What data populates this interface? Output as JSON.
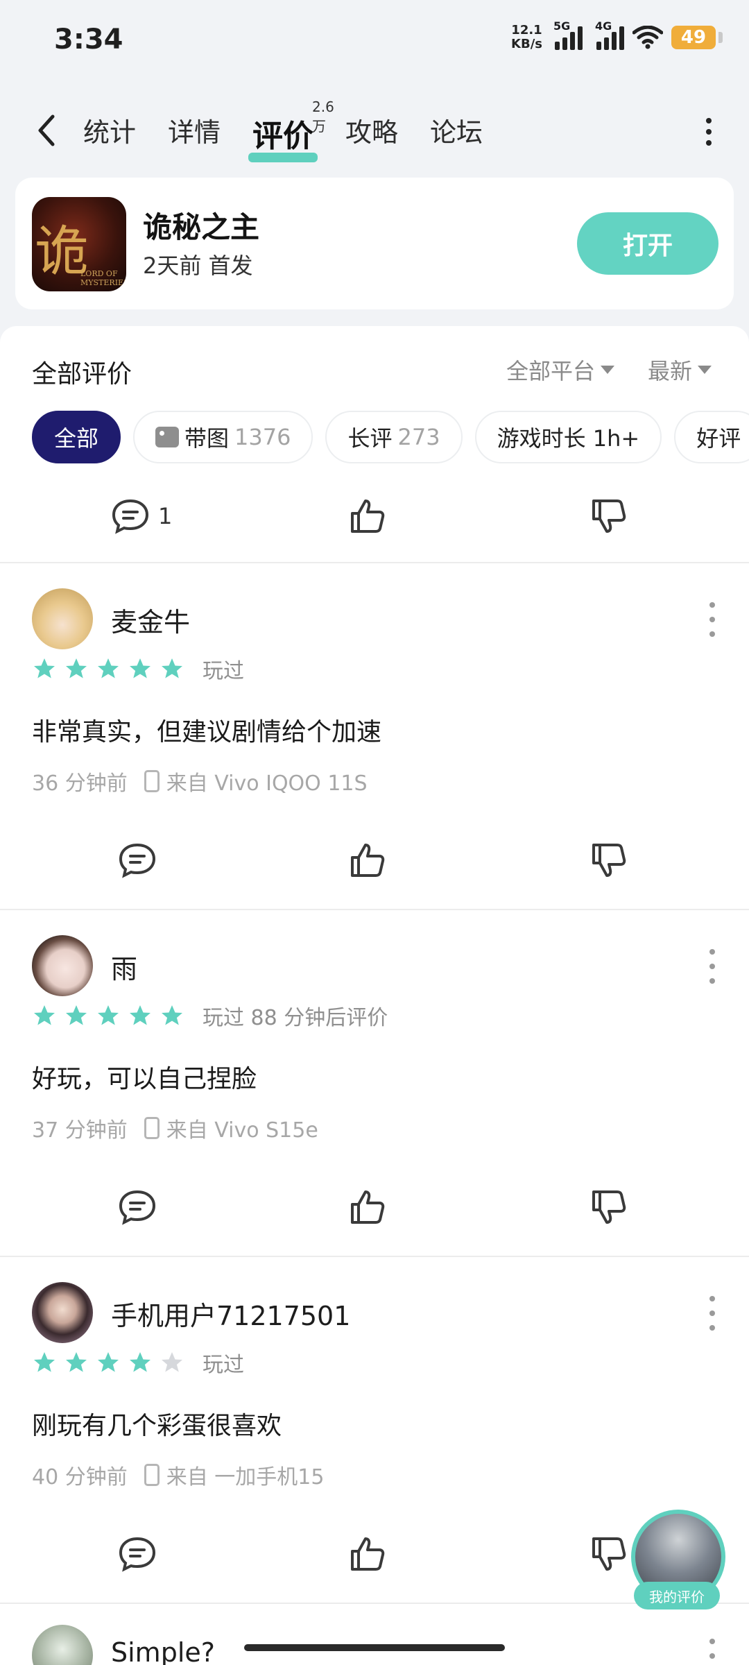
{
  "status": {
    "time": "3:34",
    "net_speed_value": "12.1",
    "net_speed_unit": "KB/s",
    "sig1": "5G",
    "sig2": "4G",
    "battery": "49"
  },
  "nav": {
    "tabs": [
      {
        "label": "统计"
      },
      {
        "label": "详情"
      },
      {
        "label": "评价",
        "badge": "2.6万"
      },
      {
        "label": "攻略"
      },
      {
        "label": "论坛"
      }
    ]
  },
  "app": {
    "name": "诡秘之主",
    "meta": "2天前 首发",
    "open_label": "打开",
    "icon_text": "诡秘",
    "icon_sub": "LORD OF MYSTERIES"
  },
  "reviews_header": {
    "title": "全部评价",
    "platform": "全部平台",
    "sort": "最新"
  },
  "chips": [
    {
      "label": "全部"
    },
    {
      "label": "带图",
      "count": "1376"
    },
    {
      "label": "长评",
      "count": "273"
    },
    {
      "label": "游戏时长 1h+"
    },
    {
      "label": "好评"
    }
  ],
  "top_actions": {
    "comment_count": "1"
  },
  "reviews": [
    {
      "user": "麦金牛",
      "rating": 5,
      "played": "玩过",
      "text": "非常真实，但建议剧情给个加速",
      "time": "36 分钟前",
      "device": "来自 Vivo IQOO 11S"
    },
    {
      "user": "雨",
      "rating": 5,
      "played": "玩过 88 分钟后评价",
      "text": "好玩，可以自己捏脸",
      "time": "37 分钟前",
      "device": "来自 Vivo S15e"
    },
    {
      "user": "手机用户71217501",
      "rating": 4,
      "played": "玩过",
      "text": "刚玩有几个彩蛋很喜欢",
      "time": "40 分钟前",
      "device": "来自 一加手机15"
    },
    {
      "user": "Simple?"
    }
  ],
  "fab": {
    "label": "我的评价"
  },
  "colors": {
    "accent": "#5fd0be",
    "chip_active": "#1f1c6e"
  }
}
